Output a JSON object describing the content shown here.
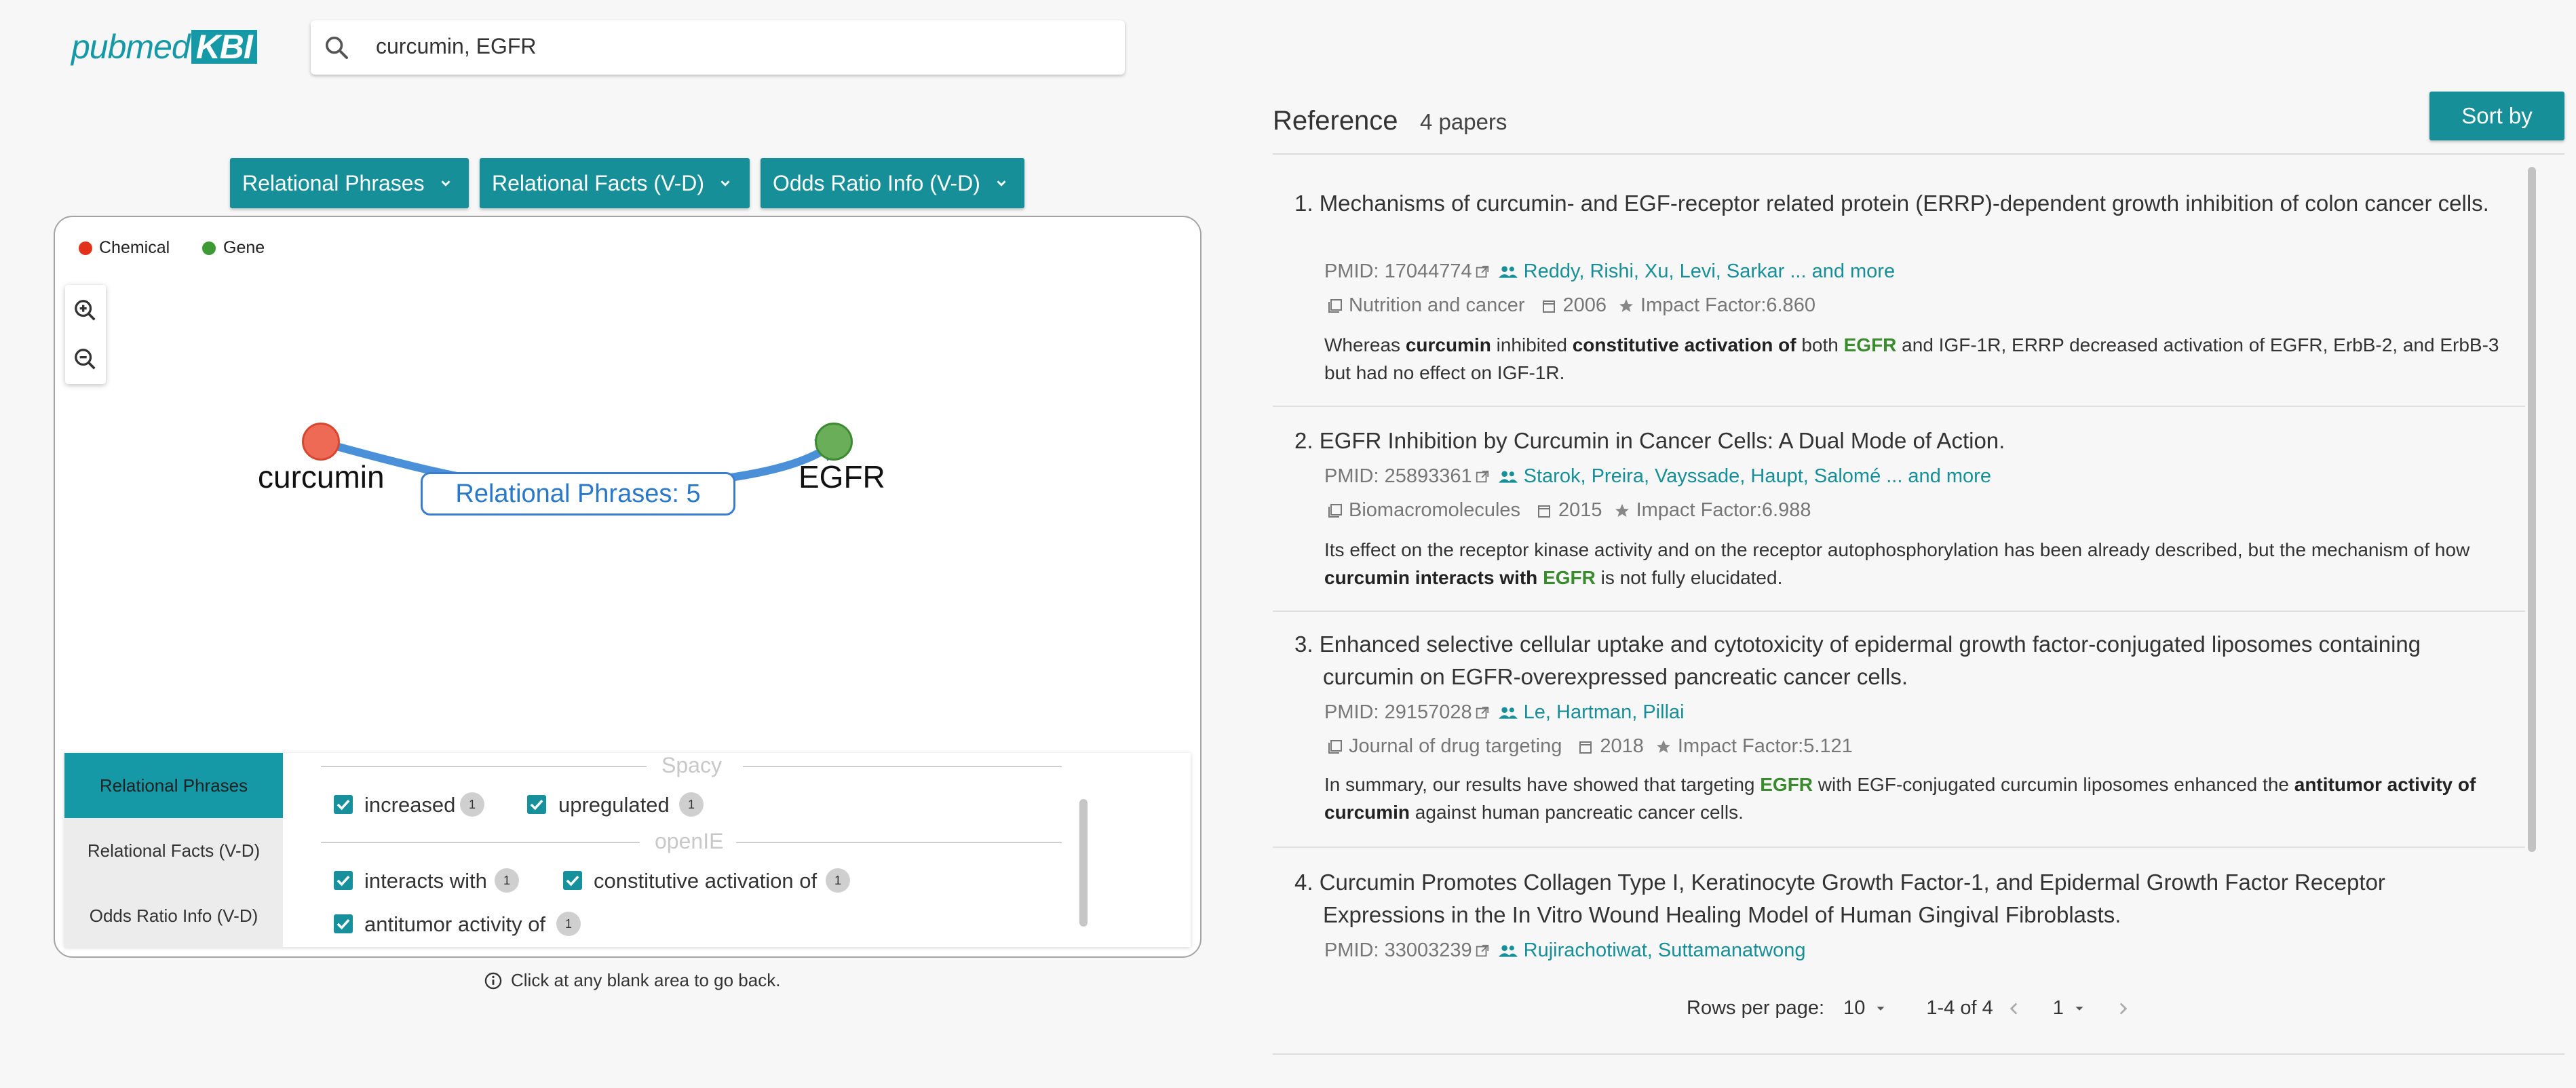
{
  "app": {
    "logo_text": "pubmed",
    "logo_badge": "KBI"
  },
  "search": {
    "value": "curcumin, EGFR"
  },
  "dropdowns": [
    {
      "label": "Relational Phrases"
    },
    {
      "label": "Relational Facts (V-D)"
    },
    {
      "label": "Odds Ratio Info (V-D)"
    }
  ],
  "legend": [
    {
      "label": "Chemical",
      "color": "#e2321c"
    },
    {
      "label": "Gene",
      "color": "#3d9a35"
    }
  ],
  "graph": {
    "source": {
      "label": "curcumin",
      "color": "#ef6a55"
    },
    "target": {
      "label": "EGFR",
      "color": "#6aae5a"
    },
    "edge_label": "Relational Phrases: 5"
  },
  "tabs": [
    {
      "label": "Relational Phrases",
      "active": true
    },
    {
      "label": "Relational Facts (V-D)",
      "active": false
    },
    {
      "label": "Odds Ratio Info (V-D)",
      "active": false
    }
  ],
  "phrases": {
    "spacy_title": "Spacy",
    "openie_title": "openIE",
    "spacy": [
      {
        "label": "increased",
        "count": "1",
        "checked": true
      },
      {
        "label": "upregulated",
        "count": "1",
        "checked": true
      }
    ],
    "openie": [
      {
        "label": "interacts with",
        "count": "1",
        "checked": true
      },
      {
        "label": "constitutive activation of",
        "count": "1",
        "checked": true
      },
      {
        "label": "antitumor activity of",
        "count": "1",
        "checked": true
      }
    ]
  },
  "hint": "Click at any blank area to go back.",
  "reference": {
    "title": "Reference",
    "count": "4 papers",
    "sort_label": "Sort by",
    "papers": [
      {
        "title": "1. Mechanisms of curcumin- and EGF-receptor related protein (ERRP)-dependent growth inhibition of colon cancer cells.",
        "pmid": "PMID: 17044774",
        "authors": "Reddy, Rishi, Xu, Levi, Sarkar",
        "more": "... and more",
        "journal": "Nutrition and cancer",
        "year": "2006",
        "impact": "Impact Factor:6.860",
        "abstract": [
          {
            "t": "Whereas "
          },
          {
            "t": "curcumin",
            "k": "b"
          },
          {
            "t": " inhibited "
          },
          {
            "t": "constitutive activation of",
            "k": "b"
          },
          {
            "t": " both "
          },
          {
            "t": "EGFR",
            "k": "g"
          },
          {
            "t": " and IGF-1R, ERRP decreased activation of EGFR, ErbB-2, and ErbB-3 but had no effect on IGF-1R."
          }
        ]
      },
      {
        "title": "2. EGFR Inhibition by Curcumin in Cancer Cells: A Dual Mode of Action.",
        "pmid": "PMID: 25893361",
        "authors": "Starok, Preira, Vayssade, Haupt, Salomé",
        "more": "... and more",
        "journal": "Biomacromolecules",
        "year": "2015",
        "impact": "Impact Factor:6.988",
        "abstract": [
          {
            "t": "Its effect on the receptor kinase activity and on the receptor autophosphorylation has been already described, but the mechanism of how "
          },
          {
            "t": "curcumin interacts with",
            "k": "b"
          },
          {
            "t": " "
          },
          {
            "t": "EGFR",
            "k": "g"
          },
          {
            "t": " is not fully elucidated."
          }
        ]
      },
      {
        "title": "3. Enhanced selective cellular uptake and cytotoxicity of epidermal growth factor-conjugated liposomes containing curcumin on EGFR-overexpressed pancreatic cancer cells.",
        "pmid": "PMID: 29157028",
        "authors": "Le, Hartman, Pillai",
        "more": "",
        "journal": "Journal of drug targeting",
        "year": "2018",
        "impact": "Impact Factor:5.121",
        "abstract": [
          {
            "t": "In summary, our results have showed that targeting "
          },
          {
            "t": "EGFR",
            "k": "g"
          },
          {
            "t": " with EGF-conjugated curcumin liposomes enhanced the "
          },
          {
            "t": "antitumor activity of curcumin",
            "k": "b"
          },
          {
            "t": " against human pancreatic cancer cells."
          }
        ]
      },
      {
        "title": "4. Curcumin Promotes Collagen Type I, Keratinocyte Growth Factor-1, and Epidermal Growth Factor Receptor Expressions in the In Vitro Wound Healing Model of Human Gingival Fibroblasts.",
        "pmid": "PMID: 33003239",
        "authors": "Rujirachotiwat, Suttamanatwong",
        "more": "",
        "journal": "",
        "year": "",
        "impact": "",
        "abstract": []
      }
    ]
  },
  "pagination": {
    "rows_label": "Rows per page:",
    "rows_value": "10",
    "range": "1-4 of 4",
    "page": "1"
  },
  "colors": {
    "accent": "#168f99",
    "edge": "#4a90d9",
    "gene_text": "#3a8b2e"
  },
  "icons": [
    "search-icon",
    "chevron-down-icon",
    "zoom-in-icon",
    "zoom-out-icon",
    "info-icon",
    "external-link-icon",
    "people-icon",
    "journal-icon",
    "calendar-icon",
    "star-icon",
    "chevron-left-icon",
    "chevron-right-icon",
    "check-icon"
  ]
}
